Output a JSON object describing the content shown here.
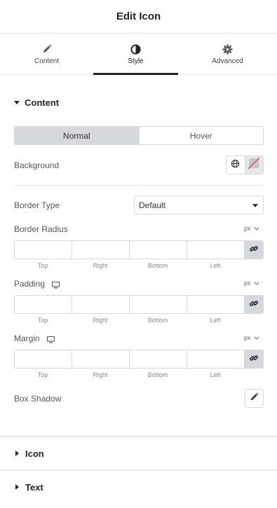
{
  "header": {
    "title": "Edit Icon"
  },
  "tabs": [
    {
      "label": "Content",
      "icon": "pencil-icon"
    },
    {
      "label": "Style",
      "icon": "contrast-icon",
      "active": true
    },
    {
      "label": "Advanced",
      "icon": "gear-icon"
    }
  ],
  "content_section": {
    "title": "Content",
    "state_toggle": {
      "options": [
        "Normal",
        "Hover"
      ],
      "selected": "Normal"
    },
    "background": {
      "label": "Background"
    },
    "border_type": {
      "label": "Border Type",
      "value": "Default"
    },
    "border_radius": {
      "label": "Border Radius",
      "unit": "px",
      "sides": [
        "Top",
        "Right",
        "Bottom",
        "Left"
      ]
    },
    "padding": {
      "label": "Padding",
      "unit": "px",
      "sides": [
        "Top",
        "Right",
        "Bottom",
        "Left"
      ]
    },
    "margin": {
      "label": "Margin",
      "unit": "px",
      "sides": [
        "Top",
        "Right",
        "Bottom",
        "Left"
      ]
    },
    "box_shadow": {
      "label": "Box Shadow"
    }
  },
  "collapsed_sections": [
    {
      "title": "Icon"
    },
    {
      "title": "Text"
    }
  ],
  "colors": {
    "accent_dark": "#1f2124",
    "border": "#d5d8dc",
    "toggle_selected": "#d5d8dc",
    "strike": "#e2574c"
  }
}
